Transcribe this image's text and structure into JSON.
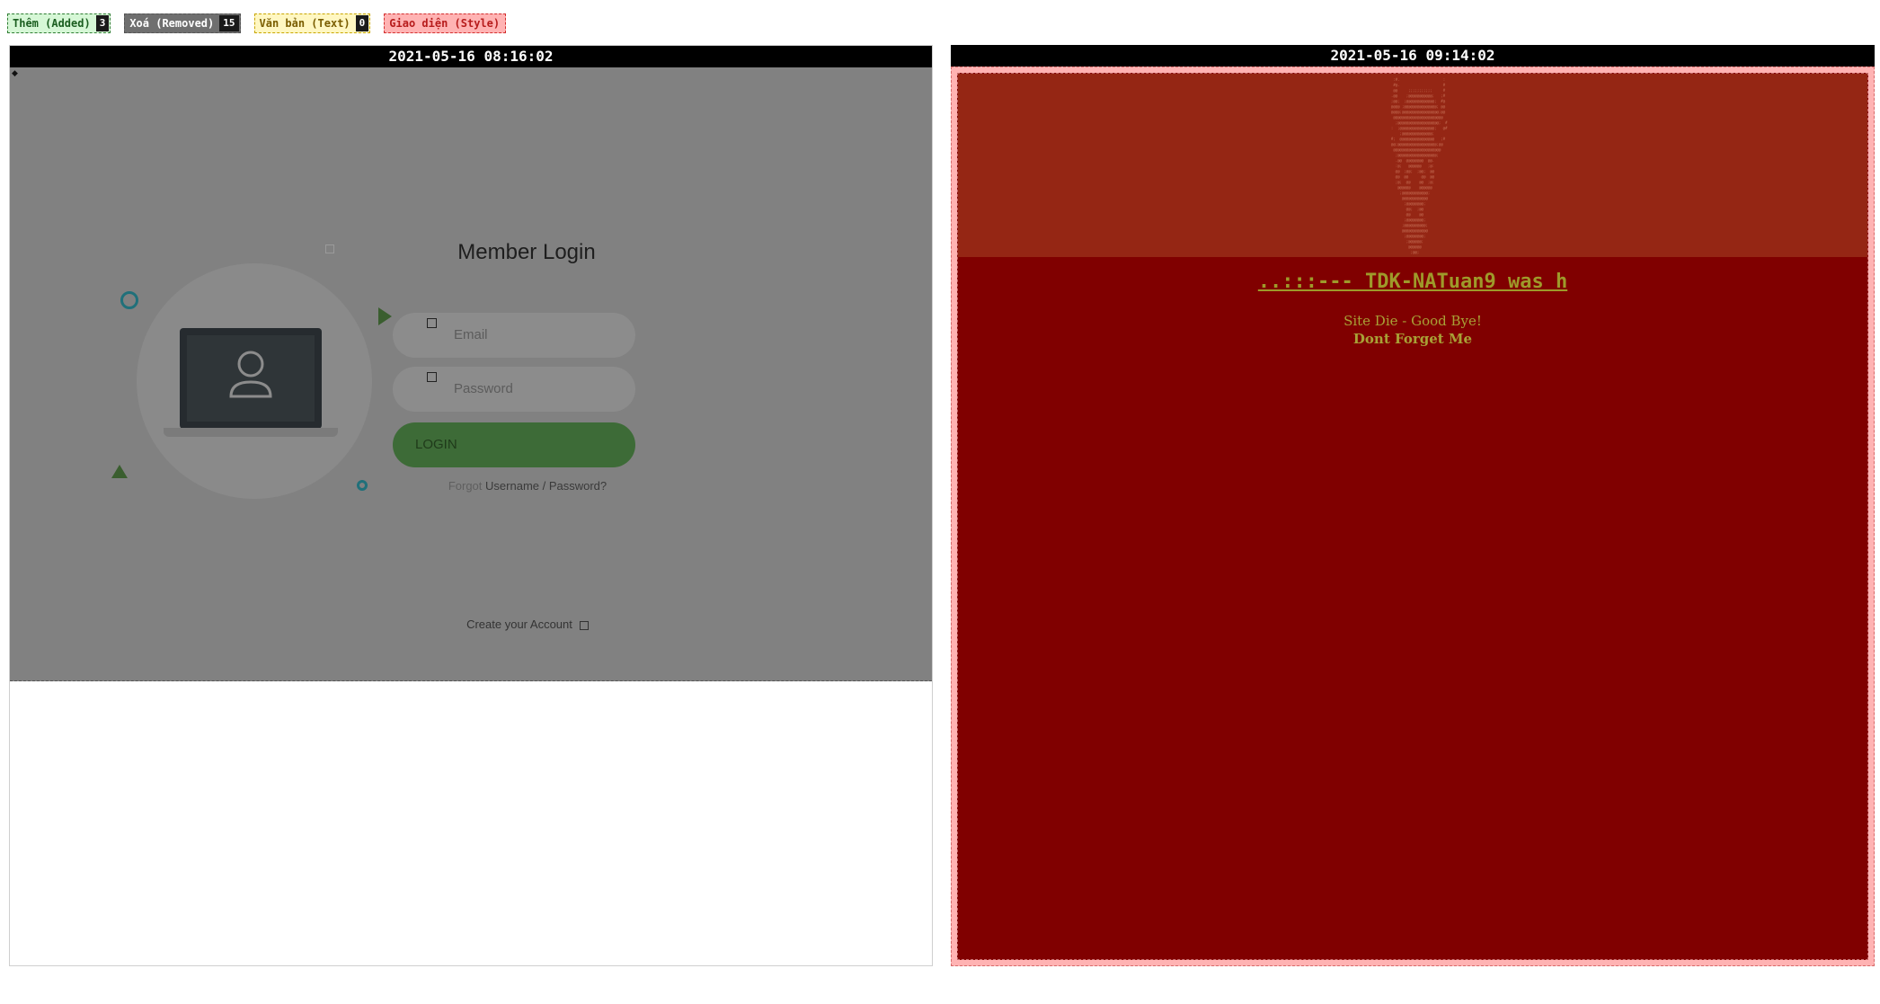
{
  "legend": {
    "added": {
      "label": "Thêm (Added)",
      "count": "3"
    },
    "removed": {
      "label": "Xoá (Removed)",
      "count": "15"
    },
    "text": {
      "label": "Văn bản (Text)",
      "count": "0"
    },
    "style": {
      "label": "Giao diện (Style)"
    }
  },
  "left": {
    "timestamp": "2021-05-16 08:16:02",
    "login": {
      "title": "Member Login",
      "email_placeholder": "Email",
      "password_placeholder": "Password",
      "button": "LOGIN",
      "forgot_prefix": "Forgot",
      "forgot_link": "Username / Password?",
      "create_account": "Create your Account"
    },
    "colors": {
      "overlay": "#818181",
      "button": "#3d6b37"
    }
  },
  "right": {
    "timestamp": "2021-05-16 09:14:02",
    "title": "..:::--- TDK-NATuan9 was h",
    "line1": "Site Die - Good Bye!",
    "line2": "Dont Forget Me",
    "colors": {
      "background": "#800000",
      "banner": "#952614",
      "text": "#a8a136",
      "border": "#ffb3b3"
    }
  }
}
